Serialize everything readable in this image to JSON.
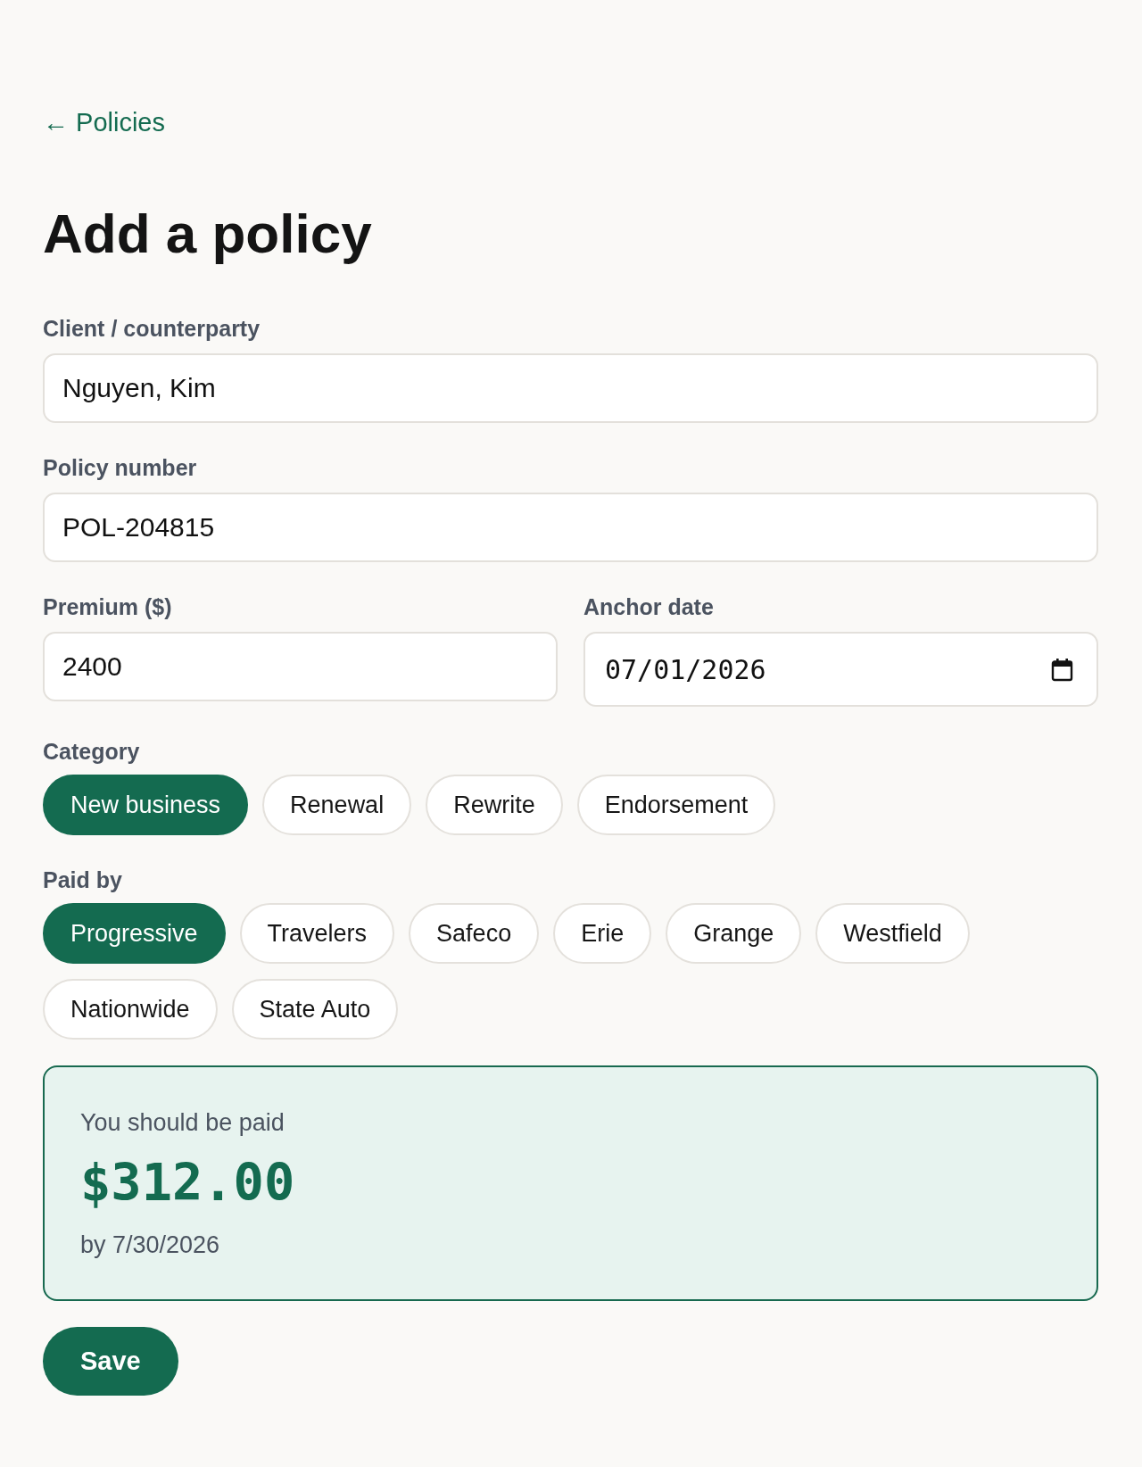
{
  "back_link": {
    "label": "← Policies"
  },
  "title": "Add a policy",
  "field_rows": [
    {
      "fields": [
        {
          "kind": "text",
          "label": "Client / counterparty",
          "value": "Nguyen, Kim"
        }
      ]
    },
    {
      "fields": [
        {
          "kind": "text",
          "label": "Policy number",
          "value": "POL-204815"
        }
      ]
    },
    {
      "fields": [
        {
          "kind": "text",
          "label": "Premium ($)",
          "value": "2400"
        },
        {
          "kind": "date",
          "label": "Anchor date",
          "value": "07/01/2026"
        }
      ]
    }
  ],
  "choice_groups": [
    {
      "label": "Category",
      "options": [
        {
          "label": "New business",
          "selected": true
        },
        {
          "label": "Renewal",
          "selected": false
        },
        {
          "label": "Rewrite",
          "selected": false
        },
        {
          "label": "Endorsement",
          "selected": false
        }
      ]
    },
    {
      "label": "Paid by",
      "options": [
        {
          "label": "Progressive",
          "selected": true
        },
        {
          "label": "Travelers",
          "selected": false
        },
        {
          "label": "Safeco",
          "selected": false
        },
        {
          "label": "Erie",
          "selected": false
        },
        {
          "label": "Grange",
          "selected": false
        },
        {
          "label": "Westfield",
          "selected": false
        },
        {
          "label": "Nationwide",
          "selected": false
        },
        {
          "label": "State Auto",
          "selected": false
        }
      ]
    }
  ],
  "result": {
    "caption": "You should be paid",
    "amount": "$312.00",
    "due": "by 7/30/2026"
  },
  "save_button": {
    "label": "Save"
  }
}
